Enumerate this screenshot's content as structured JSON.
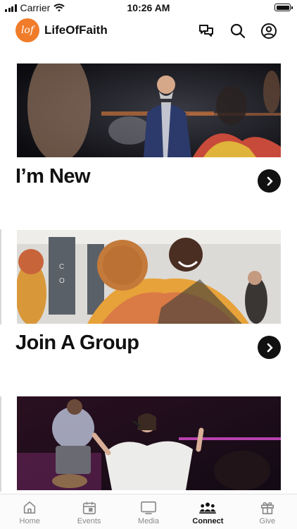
{
  "status": {
    "carrier": "Carrier",
    "time": "10:26 AM"
  },
  "header": {
    "logo_text": "lof",
    "title": "LifeOfFaith",
    "icons": [
      "chat-icon",
      "search-icon",
      "profile-icon"
    ]
  },
  "cards": [
    {
      "title": "I’m New",
      "image": "pastor-preaching-photo"
    },
    {
      "title": "Join A Group",
      "image": "people-hugging-photo"
    },
    {
      "title": "",
      "image": "worship-singer-photo"
    }
  ],
  "tabs": [
    {
      "label": "Home",
      "icon": "home-icon",
      "active": false
    },
    {
      "label": "Events",
      "icon": "calendar-icon",
      "active": false
    },
    {
      "label": "Media",
      "icon": "tv-icon",
      "active": false
    },
    {
      "label": "Connect",
      "icon": "people-icon",
      "active": true
    },
    {
      "label": "Give",
      "icon": "gift-icon",
      "active": false
    }
  ],
  "colors": {
    "brand": "#f07c2a",
    "active_tab": "#111111",
    "inactive_tab": "#8a8a8a"
  }
}
